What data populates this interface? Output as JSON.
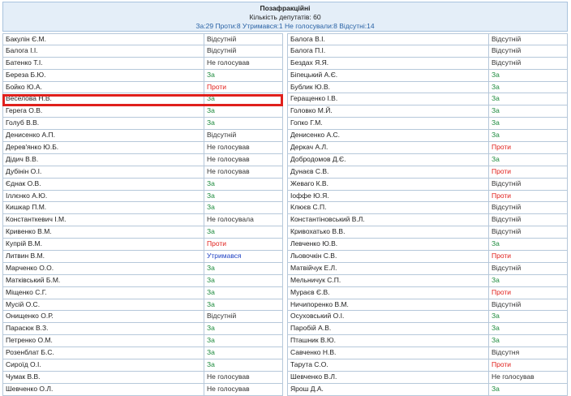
{
  "header": {
    "title": "Позафракційні",
    "deputies": "Кількість депутатів: 60",
    "summary": "За:29 Проти:8 Утримався:1 Не голосували:8 Відсутні:14"
  },
  "left": [
    {
      "name": "Бакулін Є.М.",
      "status": "Відсутній",
      "cls": "vid"
    },
    {
      "name": "Балога І.І.",
      "status": "Відсутній",
      "cls": "vid"
    },
    {
      "name": "Батенко Т.І.",
      "status": "Не голосував",
      "cls": "ng"
    },
    {
      "name": "Береза Б.Ю.",
      "status": "За",
      "cls": "za"
    },
    {
      "name": "Бойко Ю.А.",
      "status": "Проти",
      "cls": "proty"
    },
    {
      "name": "Веселова Н.В.",
      "status": "За",
      "cls": "za"
    },
    {
      "name": "Герега О.В.",
      "status": "За",
      "cls": "za"
    },
    {
      "name": "Голуб В.В.",
      "status": "За",
      "cls": "za"
    },
    {
      "name": "Денисенко А.П.",
      "status": "Відсутній",
      "cls": "vid"
    },
    {
      "name": "Дерев'янко Ю.Б.",
      "status": "Не голосував",
      "cls": "ng"
    },
    {
      "name": "Дідич В.В.",
      "status": "Не голосував",
      "cls": "ng"
    },
    {
      "name": "Дубінін О.І.",
      "status": "Не голосував",
      "cls": "ng"
    },
    {
      "name": "Єднак О.В.",
      "status": "За",
      "cls": "za"
    },
    {
      "name": "Іллєнко А.Ю.",
      "status": "За",
      "cls": "za"
    },
    {
      "name": "Кишкар П.М.",
      "status": "За",
      "cls": "za"
    },
    {
      "name": "Константкевич І.М.",
      "status": "Не голосувала",
      "cls": "ng"
    },
    {
      "name": "Кривенко В.М.",
      "status": "За",
      "cls": "za"
    },
    {
      "name": "Купрій В.М.",
      "status": "Проти",
      "cls": "proty"
    },
    {
      "name": "Литвин В.М.",
      "status": "Утримався",
      "cls": "utr"
    },
    {
      "name": "Марченко О.О.",
      "status": "За",
      "cls": "za"
    },
    {
      "name": "Матківський Б.М.",
      "status": "За",
      "cls": "za"
    },
    {
      "name": "Міщенко С.Г.",
      "status": "За",
      "cls": "za"
    },
    {
      "name": "Мусій О.С.",
      "status": "За",
      "cls": "za"
    },
    {
      "name": "Онищенко О.Р.",
      "status": "Відсутній",
      "cls": "vid"
    },
    {
      "name": "Парасюк В.З.",
      "status": "За",
      "cls": "za"
    },
    {
      "name": "Петренко О.М.",
      "status": "За",
      "cls": "za"
    },
    {
      "name": "Розенблат Б.С.",
      "status": "За",
      "cls": "za"
    },
    {
      "name": "Сироїд О.І.",
      "status": "За",
      "cls": "za"
    },
    {
      "name": "Чумак В.В.",
      "status": "Не голосував",
      "cls": "ng"
    },
    {
      "name": "Шевченко О.Л.",
      "status": "Не голосував",
      "cls": "ng"
    }
  ],
  "right": [
    {
      "name": "Балога В.І.",
      "status": "Відсутній",
      "cls": "vid"
    },
    {
      "name": "Балога П.І.",
      "status": "Відсутній",
      "cls": "vid"
    },
    {
      "name": "Бездах Я.Я.",
      "status": "Відсутній",
      "cls": "vid"
    },
    {
      "name": "Біпецький А.Є.",
      "status": "За",
      "cls": "za"
    },
    {
      "name": "Бублик Ю.В.",
      "status": "За",
      "cls": "za"
    },
    {
      "name": "Геращенко І.В.",
      "status": "За",
      "cls": "za"
    },
    {
      "name": "Головко М.Й.",
      "status": "За",
      "cls": "za"
    },
    {
      "name": "Гопко Г.М.",
      "status": "За",
      "cls": "za"
    },
    {
      "name": "Денисенко А.С.",
      "status": "За",
      "cls": "za"
    },
    {
      "name": "Деркач А.Л.",
      "status": "Проти",
      "cls": "proty"
    },
    {
      "name": "Добродомов Д.Є.",
      "status": "За",
      "cls": "za"
    },
    {
      "name": "Дунаєв С.В.",
      "status": "Проти",
      "cls": "proty"
    },
    {
      "name": "Жеваго К.В.",
      "status": "Відсутній",
      "cls": "vid"
    },
    {
      "name": "Іоффе Ю.Я.",
      "status": "Проти",
      "cls": "proty"
    },
    {
      "name": "Клюєв С.П.",
      "status": "Відсутній",
      "cls": "vid"
    },
    {
      "name": "Константіновський В.Л.",
      "status": "Відсутній",
      "cls": "vid"
    },
    {
      "name": "Кривохатько В.В.",
      "status": "Відсутній",
      "cls": "vid"
    },
    {
      "name": "Левченко Ю.В.",
      "status": "За",
      "cls": "za"
    },
    {
      "name": "Льовочкін С.В.",
      "status": "Проти",
      "cls": "proty"
    },
    {
      "name": "Матвійчук Е.Л.",
      "status": "Відсутній",
      "cls": "vid"
    },
    {
      "name": "Мельничук С.П.",
      "status": "За",
      "cls": "za"
    },
    {
      "name": "Мураєв Є.В.",
      "status": "Проти",
      "cls": "proty"
    },
    {
      "name": "Ничипоренко В.М.",
      "status": "Відсутній",
      "cls": "vid"
    },
    {
      "name": "Осуховський О.І.",
      "status": "За",
      "cls": "za"
    },
    {
      "name": "Паробій А.В.",
      "status": "За",
      "cls": "za"
    },
    {
      "name": "Пташник В.Ю.",
      "status": "За",
      "cls": "za"
    },
    {
      "name": "Савченко Н.В.",
      "status": "Відсутня",
      "cls": "vid"
    },
    {
      "name": "Тарута С.О.",
      "status": "Проти",
      "cls": "proty"
    },
    {
      "name": "Шевченко В.Л.",
      "status": "Не голосував",
      "cls": "ng"
    },
    {
      "name": "Ярош Д.А.",
      "status": "За",
      "cls": "za"
    }
  ],
  "highlighted_row": "Веселова Н.В."
}
